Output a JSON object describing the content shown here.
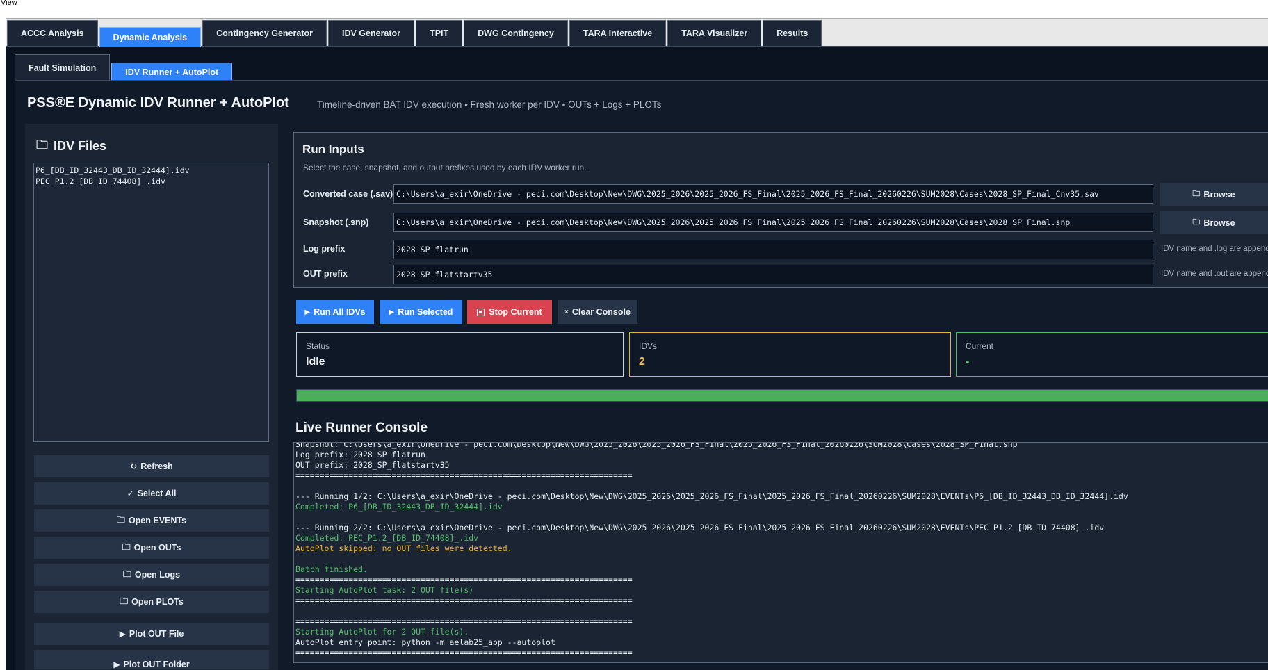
{
  "menu": {
    "view_label": "View"
  },
  "tabs": [
    {
      "label": "ACCC Analysis",
      "active": false
    },
    {
      "label": "Dynamic Analysis",
      "active": true
    },
    {
      "label": "Contingency Generator",
      "active": false
    },
    {
      "label": "IDV Generator",
      "active": false
    },
    {
      "label": "TPIT",
      "active": false
    },
    {
      "label": "DWG Contingency",
      "active": false
    },
    {
      "label": "TARA Interactive",
      "active": false
    },
    {
      "label": "TARA Visualizer",
      "active": false
    },
    {
      "label": "Results",
      "active": false
    }
  ],
  "subtabs": [
    {
      "label": "Fault Simulation",
      "active": false
    },
    {
      "label": "IDV Runner + AutoPlot",
      "active": true
    }
  ],
  "header": {
    "title": "PSS®E Dynamic IDV Runner + AutoPlot",
    "subtitle": "Timeline-driven BAT IDV execution • Fresh worker per IDV • OUTs + Logs + PLOTs"
  },
  "idv_files": {
    "heading": "IDV Files",
    "icon": "folder-icon",
    "items": [
      "P6_[DB_ID_32443_DB_ID_32444].idv",
      "PEC_P1.2_[DB_ID_74408]_.idv"
    ]
  },
  "side_buttons": {
    "refresh": {
      "icon": "↻",
      "label": "Refresh"
    },
    "select_all": {
      "icon": "✓",
      "label": "Select All"
    },
    "open_events": {
      "icon": "🗀",
      "label": "Open EVENTs"
    },
    "open_outs": {
      "icon": "🗀",
      "label": "Open OUTs"
    },
    "open_logs": {
      "icon": "🗀",
      "label": "Open Logs"
    },
    "open_plots": {
      "icon": "🗀",
      "label": "Open PLOTs"
    },
    "plot_out_file": {
      "icon": "▶",
      "label": "Plot OUT File"
    },
    "plot_out_folder": {
      "icon": "▶",
      "label": "Plot OUT Folder"
    }
  },
  "run_inputs": {
    "title": "Run Inputs",
    "subtitle": "Select the case, snapshot, and output prefixes used by each IDV worker run.",
    "case_label": "Converted case (.sav)",
    "case_value": "C:\\Users\\a_exir\\OneDrive - peci.com\\Desktop\\New\\DWG\\2025_2026\\2025_2026_FS_Final\\2025_2026_FS_Final_20260226\\SUM2028\\Cases\\2028_SP_Final_Cnv35.sav",
    "snapshot_label": "Snapshot (.snp)",
    "snapshot_value": "C:\\Users\\a_exir\\OneDrive - peci.com\\Desktop\\New\\DWG\\2025_2026\\2025_2026_FS_Final\\2025_2026_FS_Final_20260226\\SUM2028\\Cases\\2028_SP_Final.snp",
    "log_label": "Log prefix",
    "log_value": "2028_SP_flatrun",
    "log_hint": "IDV name and .log are appended",
    "out_label": "OUT prefix",
    "out_value": "2028_SP_flatstartv35",
    "out_hint": "IDV name and .out are appended",
    "browse_label": "Browse",
    "browse_icon": "🗀"
  },
  "actions": {
    "run_all": {
      "icon": "▶",
      "label": "Run All IDVs"
    },
    "run_selected": {
      "icon": "▶",
      "label": "Run Selected"
    },
    "stop_current": {
      "label": "Stop Current"
    },
    "clear_console": {
      "icon": "×",
      "label": "Clear Console"
    }
  },
  "stats": {
    "status_label": "Status",
    "status_value": "Idle",
    "idvs_label": "IDVs",
    "idvs_value": "2",
    "current_label": "Current",
    "current_value": "-"
  },
  "progress": {
    "fraction": 1.0
  },
  "console": {
    "title": "Live Runner Console",
    "lines": [
      {
        "text": "Snapshot: C:\\Users\\a_exir\\OneDrive - peci.com\\Desktop\\New\\DWG\\2025_2026\\2025_2026_FS_Final\\2025_2026_FS_Final_20260226\\SUM2028\\Cases\\2028_SP_Final.snp",
        "tone": "normal"
      },
      {
        "text": "Log prefix: 2028_SP_flatrun",
        "tone": "normal"
      },
      {
        "text": "OUT prefix: 2028_SP_flatstartv35",
        "tone": "normal"
      },
      {
        "text": "======================================================================",
        "tone": "normal"
      },
      {
        "text": "",
        "tone": "normal"
      },
      {
        "text": "--- Running 1/2: C:\\Users\\a_exir\\OneDrive - peci.com\\Desktop\\New\\DWG\\2025_2026\\2025_2026_FS_Final\\2025_2026_FS_Final_20260226\\SUM2028\\EVENTs\\P6_[DB_ID_32443_DB_ID_32444].idv",
        "tone": "normal"
      },
      {
        "text": "Completed: P6_[DB_ID_32443_DB_ID_32444].idv",
        "tone": "green"
      },
      {
        "text": "",
        "tone": "normal"
      },
      {
        "text": "--- Running 2/2: C:\\Users\\a_exir\\OneDrive - peci.com\\Desktop\\New\\DWG\\2025_2026\\2025_2026_FS_Final\\2025_2026_FS_Final_20260226\\SUM2028\\EVENTs\\PEC_P1.2_[DB_ID_74408]_.idv",
        "tone": "normal"
      },
      {
        "text": "Completed: PEC_P1.2_[DB_ID_74408]_.idv",
        "tone": "green"
      },
      {
        "text": "AutoPlot skipped: no OUT files were detected.",
        "tone": "yellow"
      },
      {
        "text": "",
        "tone": "normal"
      },
      {
        "text": "Batch finished.",
        "tone": "green"
      },
      {
        "text": "======================================================================",
        "tone": "normal"
      },
      {
        "text": "Starting AutoPlot task: 2 OUT file(s)",
        "tone": "green"
      },
      {
        "text": "======================================================================",
        "tone": "normal"
      },
      {
        "text": "",
        "tone": "normal"
      },
      {
        "text": "======================================================================",
        "tone": "normal"
      },
      {
        "text": "Starting AutoPlot for 2 OUT file(s).",
        "tone": "green"
      },
      {
        "text": "AutoPlot entry point: python -m aelab25_app --autoplot",
        "tone": "normal"
      },
      {
        "text": "======================================================================",
        "tone": "normal"
      }
    ]
  },
  "colors": {
    "accent": "#2f81f7",
    "danger": "#d9434f",
    "success": "#4cae5b",
    "warning": "#e3b341",
    "background": "#0b1220"
  }
}
